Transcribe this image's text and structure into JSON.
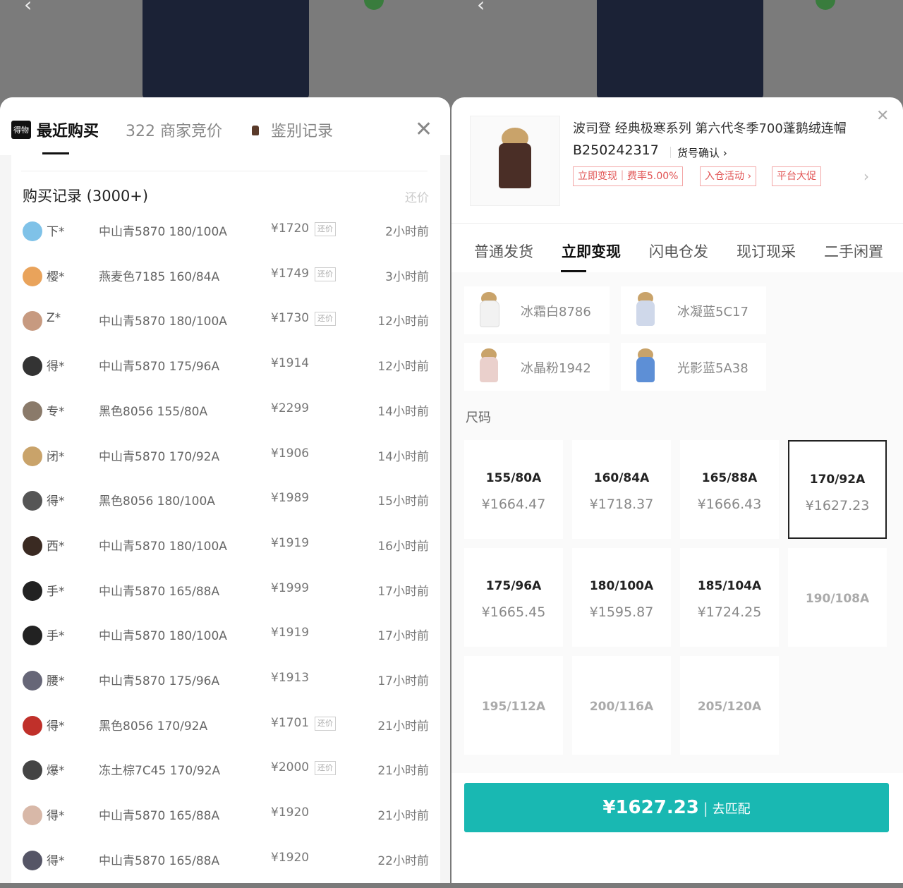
{
  "left": {
    "tabs": {
      "recent": "最近购买",
      "bids": "322 商家竞价",
      "auth": "鉴别记录"
    },
    "logo_text": "得物",
    "list": {
      "title": "购买记录 (3000+)",
      "hint": "还价"
    },
    "rows": [
      {
        "user": "下*",
        "spec": "中山青5870 180/100A",
        "price": "¥1720",
        "tag": "还价",
        "time": "2小时前",
        "avatar_color": "#7fc2e8"
      },
      {
        "user": "樱*",
        "spec": "燕麦色7185 160/84A",
        "price": "¥1749",
        "tag": "还价",
        "time": "3小时前",
        "avatar_color": "#e9a35b"
      },
      {
        "user": "Z*",
        "spec": "中山青5870 180/100A",
        "price": "¥1730",
        "tag": "还价",
        "time": "12小时前",
        "avatar_color": "#c79a80"
      },
      {
        "user": "得*",
        "spec": "中山青5870 175/96A",
        "price": "¥1914",
        "tag": "",
        "time": "12小时前",
        "avatar_color": "#333333"
      },
      {
        "user": "专*",
        "spec": "黑色8056 155/80A",
        "price": "¥2299",
        "tag": "",
        "time": "14小时前",
        "avatar_color": "#8a7a6a"
      },
      {
        "user": "闭*",
        "spec": "中山青5870 170/92A",
        "price": "¥1906",
        "tag": "",
        "time": "14小时前",
        "avatar_color": "#c9a36a"
      },
      {
        "user": "得*",
        "spec": "黑色8056 180/100A",
        "price": "¥1989",
        "tag": "",
        "time": "15小时前",
        "avatar_color": "#555555"
      },
      {
        "user": "西*",
        "spec": "中山青5870 180/100A",
        "price": "¥1919",
        "tag": "",
        "time": "16小时前",
        "avatar_color": "#3a2a22"
      },
      {
        "user": "手*",
        "spec": "中山青5870 165/88A",
        "price": "¥1999",
        "tag": "",
        "time": "17小时前",
        "avatar_color": "#222222"
      },
      {
        "user": "手*",
        "spec": "中山青5870 180/100A",
        "price": "¥1919",
        "tag": "",
        "time": "17小时前",
        "avatar_color": "#222222"
      },
      {
        "user": "腰*",
        "spec": "中山青5870 175/96A",
        "price": "¥1913",
        "tag": "",
        "time": "17小时前",
        "avatar_color": "#666677"
      },
      {
        "user": "得*",
        "spec": "黑色8056 170/92A",
        "price": "¥1701",
        "tag": "还价",
        "time": "21小时前",
        "avatar_color": "#c0302a"
      },
      {
        "user": "爆*",
        "spec": "冻土棕7C45 170/92A",
        "price": "¥2000",
        "tag": "还价",
        "time": "21小时前",
        "avatar_color": "#444444"
      },
      {
        "user": "得*",
        "spec": "中山青5870 165/88A",
        "price": "¥1920",
        "tag": "",
        "time": "21小时前",
        "avatar_color": "#d8b8a8"
      },
      {
        "user": "得*",
        "spec": "中山青5870 165/88A",
        "price": "¥1920",
        "tag": "",
        "time": "22小时前",
        "avatar_color": "#555566"
      }
    ]
  },
  "right": {
    "product": {
      "title": "波司登 经典极寒系列 第六代冬季700蓬鹅绒连帽",
      "code": "B250242317",
      "confirm": "货号确认",
      "pills": [
        "立即变现｜费率5.00%",
        "入仓活动 ›",
        "平台大促"
      ]
    },
    "ship_tabs": [
      "普通发货",
      "立即变现",
      "闪电仓发",
      "现订现采",
      "二手闲置"
    ],
    "colors": [
      {
        "name": "冰霜白8786",
        "swatch": "#f2f2f2"
      },
      {
        "name": "冰凝蓝5C17",
        "swatch": "#cfd8ea"
      },
      {
        "name": "冰晶粉1942",
        "swatch": "#ead0cc"
      },
      {
        "name": "光影蓝5A38",
        "swatch": "#5d8fd6"
      }
    ],
    "size_label": "尺码",
    "sizes": [
      {
        "size": "155/80A",
        "price": "¥1664.47"
      },
      {
        "size": "160/84A",
        "price": "¥1718.37"
      },
      {
        "size": "165/88A",
        "price": "¥1666.43"
      },
      {
        "size": "170/92A",
        "price": "¥1627.23"
      },
      {
        "size": "175/96A",
        "price": "¥1665.45"
      },
      {
        "size": "180/100A",
        "price": "¥1595.87"
      },
      {
        "size": "185/104A",
        "price": "¥1724.25"
      },
      {
        "size": "190/108A",
        "price": ""
      },
      {
        "size": "195/112A",
        "price": ""
      },
      {
        "size": "200/116A",
        "price": ""
      },
      {
        "size": "205/120A",
        "price": ""
      }
    ],
    "selected_size": "170/92A",
    "buy": {
      "amount": "¥1627.23",
      "action": "去匹配"
    },
    "accent": "#19b8b2"
  }
}
